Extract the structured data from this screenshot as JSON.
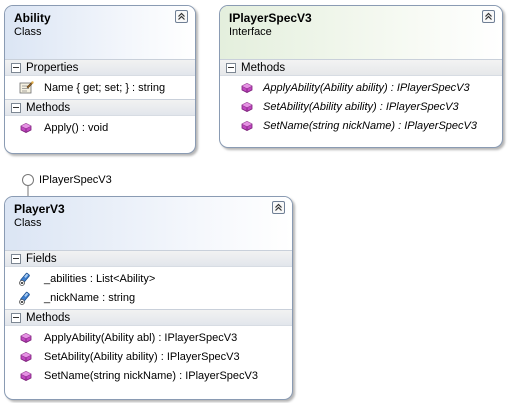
{
  "shapes": {
    "ability": {
      "name": "Ability",
      "kind": "Class",
      "properties_label": "Properties",
      "properties": [
        "Name { get; set; } : string"
      ],
      "methods_label": "Methods",
      "methods": [
        "Apply() : void"
      ]
    },
    "iplayer": {
      "name": "IPlayerSpecV3",
      "kind": "Interface",
      "methods_label": "Methods",
      "methods": [
        "ApplyAbility(Ability ability) : IPlayerSpecV3",
        "SetAbility(Ability ability) : IPlayerSpecV3",
        "SetName(string nickName) : IPlayerSpecV3"
      ]
    },
    "player": {
      "name": "PlayerV3",
      "kind": "Class",
      "fields_label": "Fields",
      "fields": [
        "_abilities : List<Ability>",
        "_nickName : string"
      ],
      "methods_label": "Methods",
      "methods": [
        "ApplyAbility(Ability abl) : IPlayerSpecV3",
        "SetAbility(Ability ability) : IPlayerSpecV3",
        "SetName(string nickName) : IPlayerSpecV3"
      ]
    }
  },
  "lollipop_label": "IPlayerSpecV3",
  "icons": {
    "property": "property-icon",
    "method": "method-icon",
    "field": "field-icon",
    "collapse": "double-chevron-up-icon"
  },
  "colors": {
    "class_header": "#dbe5f4",
    "interface_header": "#e4efdd",
    "border": "#8a9bb3",
    "method_icon": "#b23fb0",
    "field_icon": "#2f6fc0"
  }
}
